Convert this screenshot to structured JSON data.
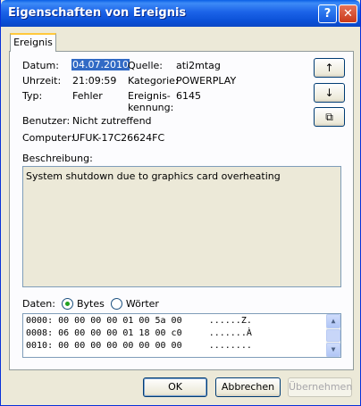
{
  "window": {
    "title": "Eigenschaften von Ereignis",
    "help_glyph": "?",
    "close_glyph": "✕"
  },
  "tab": {
    "label": "Ereignis"
  },
  "fields": {
    "datum_label": "Datum:",
    "datum_value": "04.07.2010",
    "uhrzeit_label": "Uhrzeit:",
    "uhrzeit_value": "21:09:59",
    "typ_label": "Typ:",
    "typ_value": "Fehler",
    "benutzer_label": "Benutzer:",
    "benutzer_value": "Nicht zutreffend",
    "computer_label": "Computer:",
    "computer_value": "UFUK-17C26624FC",
    "quelle_label": "Quelle:",
    "quelle_value": "ati2mtag",
    "kategorie_label": "Kategorie:",
    "kategorie_value": "POWERPLAY",
    "kennung_label_1": "Ereignis-",
    "kennung_label_2": "kennung:",
    "kennung_value": "6145"
  },
  "side_buttons": {
    "up": "↑",
    "down": "↓",
    "copy": "⧉"
  },
  "description": {
    "label": "Beschreibung:",
    "text": "System shutdown due to graphics card overheating"
  },
  "data_section": {
    "label": "Daten:",
    "radio_bytes": "Bytes",
    "radio_woerter": "Wörter",
    "selected": "Bytes",
    "lines": [
      "0000: 00 00 00 00 01 00 5a 00     ......Z.",
      "0008: 06 00 00 00 01 18 00 c0     .......À",
      "0010: 00 00 00 00 00 00 00 00     ........"
    ]
  },
  "buttons": {
    "ok": "OK",
    "cancel": "Abbrechen",
    "apply": "Übernehmen"
  }
}
